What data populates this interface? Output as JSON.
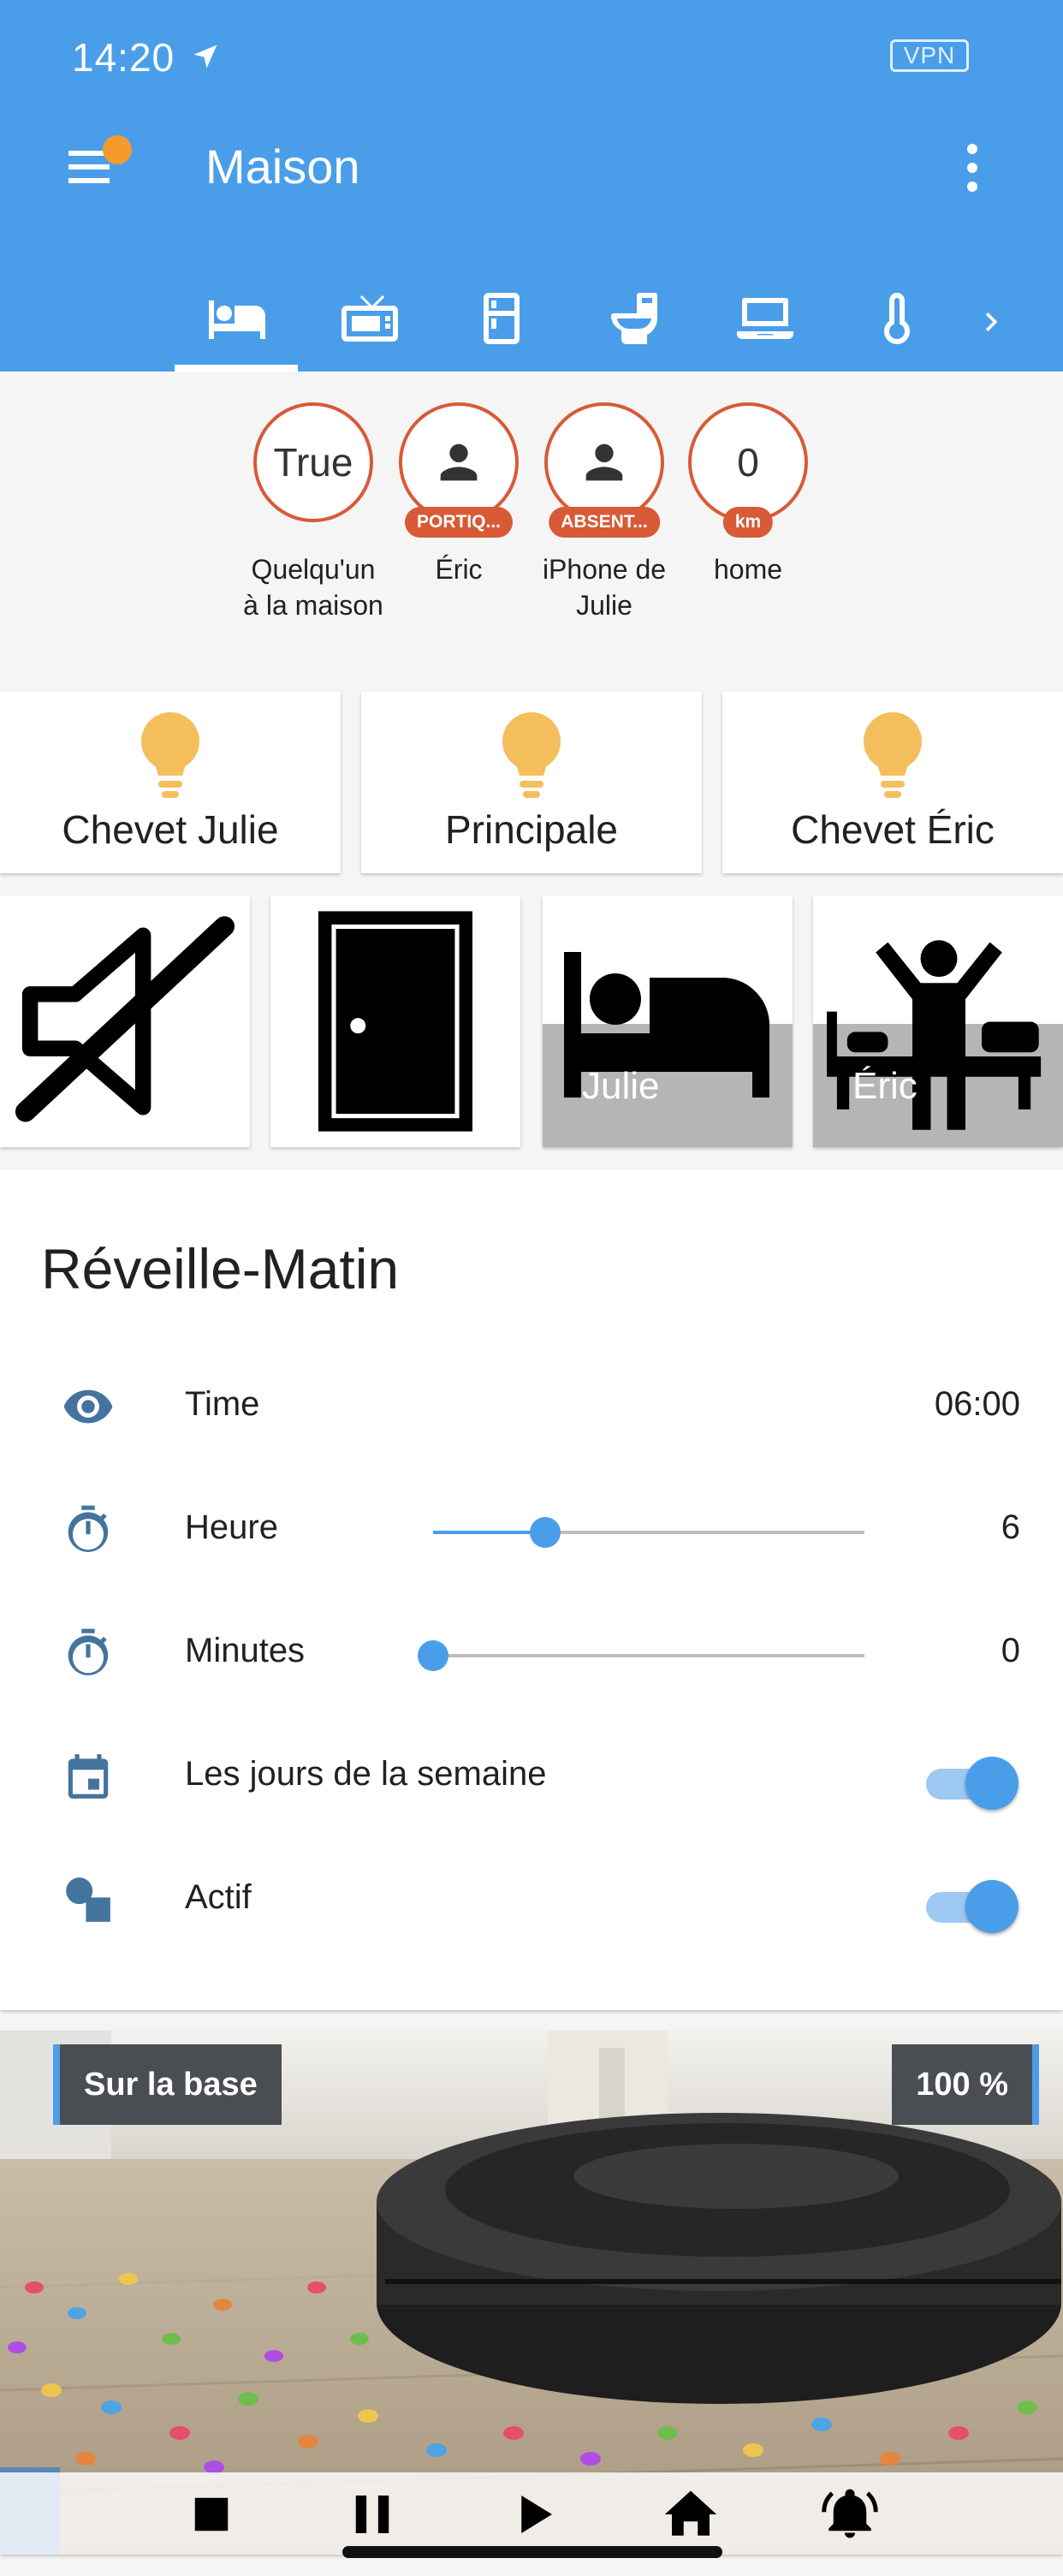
{
  "status_bar": {
    "time": "14:20",
    "vpn": "VPN"
  },
  "header": {
    "title": "Maison"
  },
  "tabs": [
    {
      "icon": "bed-icon"
    },
    {
      "icon": "tv-icon"
    },
    {
      "icon": "fridge-icon"
    },
    {
      "icon": "toilet-icon"
    },
    {
      "icon": "laptop-icon"
    },
    {
      "icon": "thermometer-icon"
    }
  ],
  "badges": [
    {
      "value": "True",
      "tag": "",
      "label": "Quelqu'un à la maison"
    },
    {
      "value": "",
      "tag": "PORTIQ...",
      "label": "Éric"
    },
    {
      "value": "",
      "tag": "ABSENT...",
      "label": "iPhone de Julie"
    },
    {
      "value": "0",
      "tag": "km",
      "label": "home"
    }
  ],
  "lights": [
    {
      "name": "Chevet Julie"
    },
    {
      "name": "Principale"
    },
    {
      "name": "Chevet Éric"
    }
  ],
  "tiles": [
    {
      "icon": "mute-speaker-icon",
      "label": ""
    },
    {
      "icon": "door-icon",
      "label": ""
    },
    {
      "icon": "sleeping-bed-icon",
      "label": "Julie"
    },
    {
      "icon": "wake-up-icon",
      "label": "Éric"
    }
  ],
  "alarm": {
    "title": "Réveille-Matin",
    "rows": {
      "time": {
        "label": "Time",
        "value": "06:00"
      },
      "heure": {
        "label": "Heure",
        "value": "6",
        "fraction": 0.26
      },
      "minutes": {
        "label": "Minutes",
        "value": "0",
        "fraction": 0.0
      },
      "jours": {
        "label": "Les jours de la semaine",
        "on": true
      },
      "actif": {
        "label": "Actif",
        "on": true
      }
    }
  },
  "robot": {
    "status": "Sur la base",
    "battery": "100 %",
    "controls": [
      "stop-icon",
      "pause-icon",
      "play-icon",
      "home-icon",
      "bell-icon"
    ]
  },
  "colors": {
    "primary": "#4a9ee9",
    "accent": "#d85a36",
    "bulb": "#f4be5c",
    "notification": "#f49b2b"
  }
}
